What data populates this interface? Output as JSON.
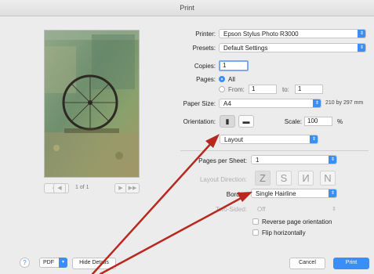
{
  "window": {
    "title": "Print"
  },
  "preview": {
    "page_indicator": "1 of 1",
    "first_label": "◀◀",
    "prev_label": "◀",
    "next_label": "▶",
    "last_label": "▶▶"
  },
  "printer": {
    "label": "Printer:",
    "value": "Epson Stylus Photo R3000"
  },
  "presets": {
    "label": "Presets:",
    "value": "Default Settings"
  },
  "copies": {
    "label": "Copies:",
    "value": "1"
  },
  "pages": {
    "label": "Pages:",
    "all_label": "All",
    "from_label": "From:",
    "from_value": "1",
    "to_label": "to:",
    "to_value": "1"
  },
  "paper_size": {
    "label": "Paper Size:",
    "value": "A4",
    "dimensions": "210 by 297 mm"
  },
  "orientation": {
    "label": "Orientation:",
    "portrait_icon": "portrait-icon",
    "landscape_icon": "landscape-icon"
  },
  "scale": {
    "label": "Scale:",
    "value": "100",
    "unit": "%"
  },
  "section": {
    "value": "Layout"
  },
  "pages_per_sheet": {
    "label": "Pages per Sheet:",
    "value": "1"
  },
  "layout_direction": {
    "label": "Layout Direction:",
    "glyphs": [
      "Z",
      "S",
      "И",
      "N"
    ]
  },
  "border": {
    "label": "Border:",
    "value": "Single Hairline"
  },
  "two_sided": {
    "label": "Two-Sided:",
    "value": "Off"
  },
  "options": {
    "reverse_label": "Reverse page orientation",
    "flip_label": "Flip horizontally"
  },
  "footer": {
    "help": "?",
    "pdf": "PDF",
    "hide_details": "Hide Details",
    "cancel": "Cancel",
    "print": "Print"
  },
  "colors": {
    "accent": "#3a8ef6",
    "annotation": "#b8281f"
  }
}
